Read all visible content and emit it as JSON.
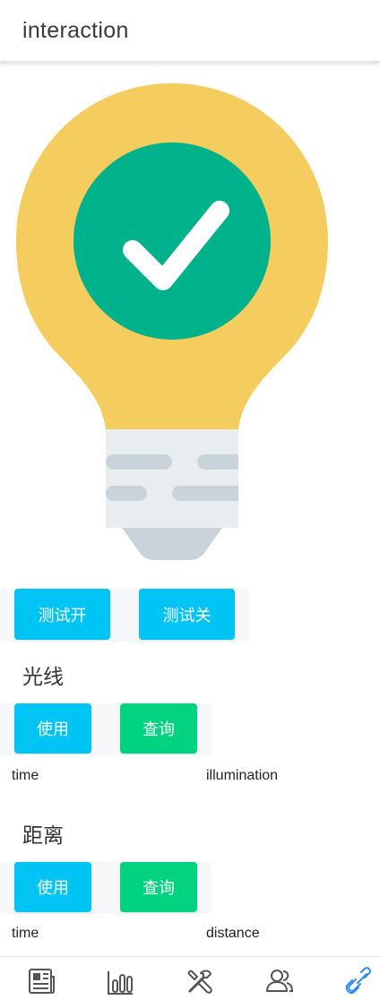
{
  "header": {
    "title": "interaction"
  },
  "test_controls": {
    "on_label": "测试开",
    "off_label": "测试关"
  },
  "light_section": {
    "title": "光线",
    "use_label": "使用",
    "query_label": "查询",
    "columns": [
      "time",
      "illumination"
    ]
  },
  "distance_section": {
    "title": "距离",
    "use_label": "使用",
    "query_label": "查询",
    "columns": [
      "time",
      "distance"
    ]
  },
  "bottom_nav": {
    "items": [
      "news-icon",
      "chart-icon",
      "tools-icon",
      "users-icon",
      "link-icon"
    ],
    "active_index": 4
  },
  "colors": {
    "bulb_yellow": "#f5cd5e",
    "check_circle": "#00b28b",
    "button_blue": "#00c4f3",
    "button_green": "#00d37f",
    "nav_active": "#2d8cf0"
  }
}
